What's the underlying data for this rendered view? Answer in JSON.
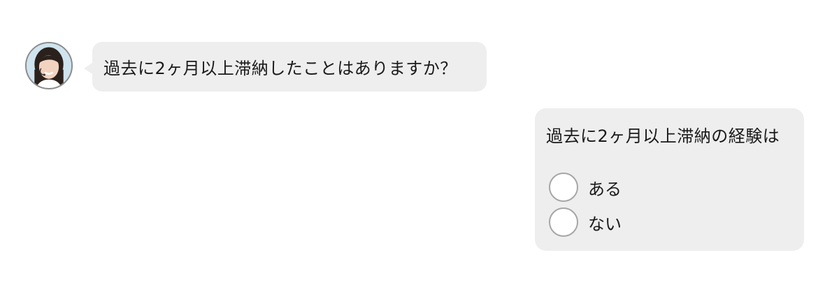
{
  "chat": {
    "operator": {
      "avatar_icon": "operator-avatar",
      "message": "過去に2ヶ月以上滞納したことはありますか？"
    },
    "user_form": {
      "heading": "過去に2ヶ月以上滞納の経験は",
      "options": [
        {
          "label": "ある",
          "selected": false
        },
        {
          "label": "ない",
          "selected": false
        }
      ]
    }
  },
  "colors": {
    "bubble_bg": "#eeeeee",
    "radio_border": "#a6a6a6",
    "text": "#1a1a1a"
  }
}
